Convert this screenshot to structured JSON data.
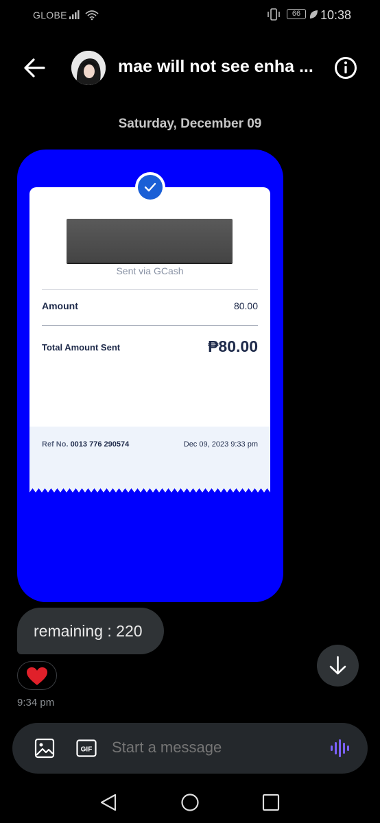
{
  "status_bar": {
    "carrier": "GLOBE",
    "battery": "66",
    "time": "10:38"
  },
  "header": {
    "title": "mae will not see enha ...",
    "back_icon": "back-arrow-icon",
    "info_icon": "info-icon"
  },
  "conversation": {
    "date_divider": "Saturday, December 09",
    "receipt": {
      "sent_via": "Sent via GCash",
      "amount_label": "Amount",
      "amount_value": "80.00",
      "total_label": "Total Amount Sent",
      "total_value": "₱80.00",
      "ref_label": "Ref No.",
      "ref_number": "0013 776 290574",
      "datetime": "Dec 09, 2023 9:33 pm"
    },
    "message_text": "remaining : 220",
    "reaction": "heart",
    "message_time": "9:34 pm"
  },
  "composer": {
    "placeholder": "Start a message"
  },
  "colors": {
    "card_blue": "#0000fe",
    "gcash_blue": "#1a5fd6",
    "bubble": "#2f3336",
    "voice_accent": "#7b61ff"
  }
}
